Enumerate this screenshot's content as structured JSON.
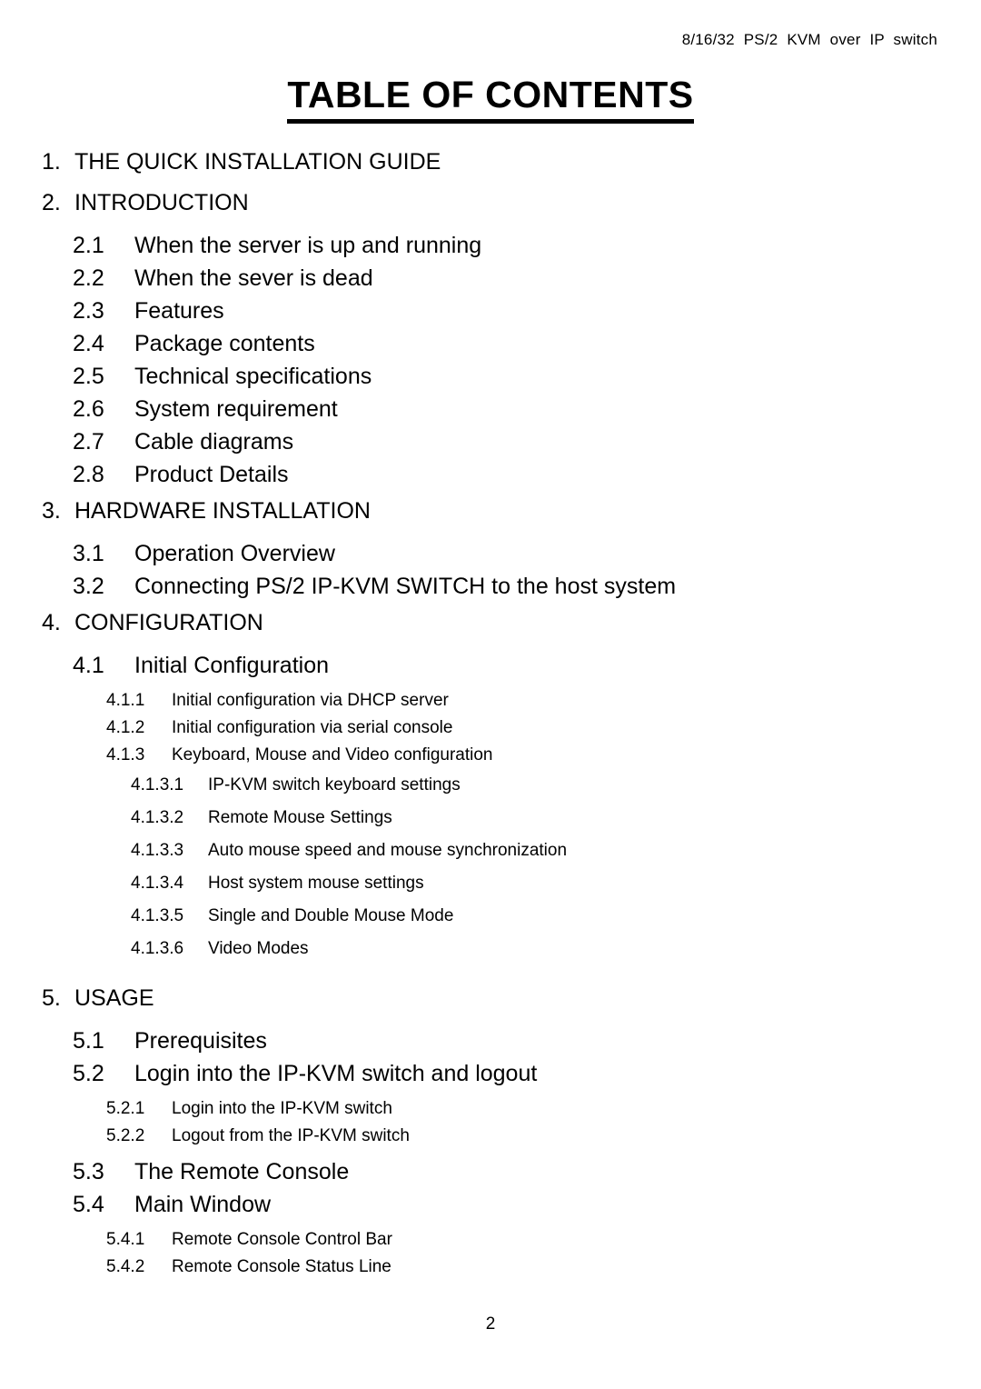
{
  "header": {
    "running_head": "8/16/32 PS/2 KVM over IP switch"
  },
  "title": "TABLE OF CONTENTS",
  "toc": {
    "entries": [
      {
        "level": 1,
        "number": "1.",
        "text": "THE QUICK INSTALLATION GUIDE",
        "gap": "none"
      },
      {
        "level": 1,
        "number": "2.",
        "text": "INTRODUCTION",
        "gap": "none"
      },
      {
        "level": 2,
        "number": "2.1",
        "text": "When the server is up and running",
        "gap": "small"
      },
      {
        "level": 2,
        "number": "2.2",
        "text": "When the sever is dead",
        "gap": "none"
      },
      {
        "level": 2,
        "number": "2.3",
        "text": "Features",
        "gap": "none"
      },
      {
        "level": 2,
        "number": "2.4",
        "text": "Package contents",
        "gap": "none"
      },
      {
        "level": 2,
        "number": "2.5",
        "text": "Technical specifications",
        "gap": "none"
      },
      {
        "level": 2,
        "number": "2.6",
        "text": "System requirement",
        "gap": "none"
      },
      {
        "level": 2,
        "number": "2.7",
        "text": "Cable diagrams",
        "gap": "none"
      },
      {
        "level": 2,
        "number": "2.8",
        "text": "Product Details",
        "gap": "none"
      },
      {
        "level": 1,
        "number": "3.",
        "text": "HARDWARE INSTALLATION",
        "gap": "none"
      },
      {
        "level": 2,
        "number": "3.1",
        "text": "Operation Overview",
        "gap": "small"
      },
      {
        "level": 2,
        "number": "3.2",
        "text": "Connecting PS/2 IP-KVM SWITCH to the host system",
        "gap": "none"
      },
      {
        "level": 1,
        "number": "4.",
        "text": "CONFIGURATION",
        "gap": "none"
      },
      {
        "level": 2,
        "number": "4.1",
        "text": "Initial Configuration",
        "gap": "small"
      },
      {
        "level": 3,
        "number": "4.1.1",
        "text": "Initial configuration via DHCP server",
        "gap": "small"
      },
      {
        "level": 3,
        "number": "4.1.2",
        "text": "Initial configuration via serial console",
        "gap": "none"
      },
      {
        "level": 3,
        "number": "4.1.3",
        "text": "Keyboard, Mouse and Video configuration",
        "gap": "none"
      },
      {
        "level": 4,
        "number": "4.1.3.1",
        "text": "IP-KVM switch keyboard settings",
        "gap": "none"
      },
      {
        "level": 4,
        "number": "4.1.3.2",
        "text": "Remote Mouse Settings",
        "gap": "none"
      },
      {
        "level": 4,
        "number": "4.1.3.3",
        "text": "Auto mouse speed and mouse synchronization",
        "gap": "none"
      },
      {
        "level": 4,
        "number": "4.1.3.4",
        "text": "Host system mouse settings",
        "gap": "none"
      },
      {
        "level": 4,
        "number": "4.1.3.5",
        "text": "Single and Double Mouse Mode",
        "gap": "none"
      },
      {
        "level": 4,
        "number": "4.1.3.6",
        "text": "Video Modes",
        "gap": "none"
      },
      {
        "level": 1,
        "number": "5.",
        "text": "USAGE",
        "gap": "large"
      },
      {
        "level": 2,
        "number": "5.1",
        "text": "Prerequisites",
        "gap": "small"
      },
      {
        "level": 2,
        "number": "5.2",
        "text": "Login into the IP-KVM switch and logout",
        "gap": "none"
      },
      {
        "level": 3,
        "number": "5.2.1",
        "text": "Login into the IP-KVM switch",
        "gap": "small"
      },
      {
        "level": 3,
        "number": "5.2.2",
        "text": "Logout from the IP-KVM switch",
        "gap": "none"
      },
      {
        "level": 2,
        "number": "5.3",
        "text": "The Remote Console",
        "gap": "small"
      },
      {
        "level": 2,
        "number": "5.4",
        "text": "Main Window",
        "gap": "none"
      },
      {
        "level": 3,
        "number": "5.4.1",
        "text": "Remote Console Control Bar",
        "gap": "small"
      },
      {
        "level": 3,
        "number": "5.4.2",
        "text": "Remote Console Status Line",
        "gap": "none"
      }
    ]
  },
  "footer": {
    "page_number": "2"
  }
}
